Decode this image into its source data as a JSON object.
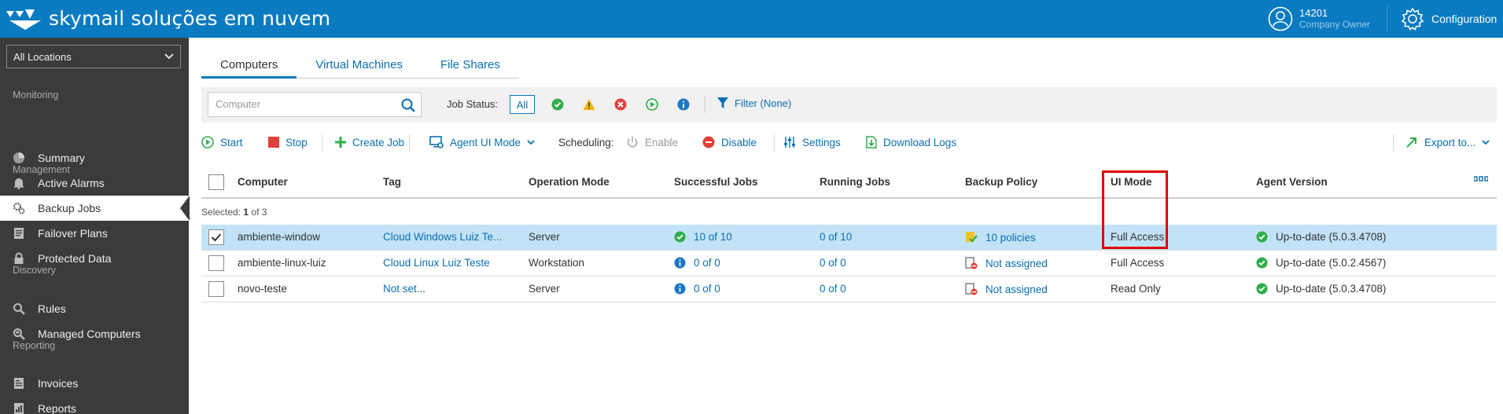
{
  "header": {
    "brand": "skymail soluções em nuvem",
    "user_id": "14201",
    "user_role": "Company Owner",
    "config_label": "Configuration"
  },
  "sidebar": {
    "location": "All Locations",
    "sections": {
      "monitoring": "Monitoring",
      "management": "Management",
      "discovery": "Discovery",
      "reporting": "Reporting"
    },
    "items": {
      "summary": "Summary",
      "active_alarms": "Active Alarms",
      "backup_jobs": "Backup Jobs",
      "failover_plans": "Failover Plans",
      "protected_data": "Protected Data",
      "rules": "Rules",
      "managed_computers": "Managed Computers",
      "invoices": "Invoices",
      "reports": "Reports"
    }
  },
  "tabs": [
    "Computers",
    "Virtual Machines",
    "File Shares"
  ],
  "filterbar": {
    "search_placeholder": "Computer",
    "job_status_label": "Job Status:",
    "all_label": "All",
    "filter_label": "Filter (None)"
  },
  "toolbar": {
    "start": "Start",
    "stop": "Stop",
    "create_job": "Create Job",
    "agent_ui_mode": "Agent UI Mode",
    "scheduling": "Scheduling:",
    "enable": "Enable",
    "disable": "Disable",
    "settings": "Settings",
    "download_logs": "Download Logs",
    "export": "Export to..."
  },
  "table": {
    "columns": [
      "Computer",
      "Tag",
      "Operation Mode",
      "Successful Jobs",
      "Running Jobs",
      "Backup Policy",
      "UI Mode",
      "Agent Version"
    ],
    "selected_prefix": "Selected:",
    "selected_count": "1",
    "selected_suffix": "of 3",
    "rows": [
      {
        "computer": "ambiente-window",
        "tag": "Cloud Windows Luiz Te...",
        "mode": "Server",
        "successful": "10 of 10",
        "running": "0 of 10",
        "policy": "10 policies",
        "ui_mode": "Full Access",
        "version": "Up-to-date (5.0.3.4708)"
      },
      {
        "computer": "ambiente-linux-luiz",
        "tag": "Cloud Linux Luiz Teste",
        "mode": "Workstation",
        "successful": "0 of 0",
        "running": "0 of 0",
        "policy": "Not assigned",
        "ui_mode": "Full Access",
        "version": "Up-to-date (5.0.2.4567)"
      },
      {
        "computer": "novo-teste",
        "tag": "Not set...",
        "mode": "Server",
        "successful": "0 of 0",
        "running": "0 of 0",
        "policy": "Not assigned",
        "ui_mode": "Read Only",
        "version": "Up-to-date (5.0.3.4708)"
      }
    ]
  },
  "colors": {
    "header_bg": "#0a7bc1",
    "sidebar_bg": "#3b3b3b",
    "link": "#0a6fb0",
    "selected_row": "#c2e3f7",
    "success": "#2fae4a",
    "highlight_box": "#e00000"
  }
}
